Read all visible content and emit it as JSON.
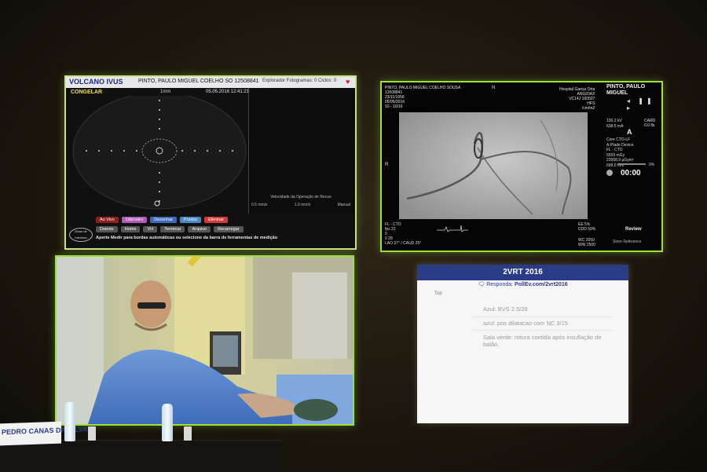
{
  "ivus": {
    "logo": "VOLCANO IVUS",
    "patient_header": "PINTO, PAULO MIGUEL COELHO SO   12508841",
    "header_right": "Explorador Fotogramas: 0   Ciclos: 0",
    "status": "CONGELAR",
    "scale_label": "1mm",
    "datetime": "05.05.2016 12:41:21",
    "pullback_label": "Velocidade da Operação de Recuo",
    "pullback_options": [
      "0.5 mm/s",
      "1.0 mm/s",
      "Manual"
    ],
    "buttons_row1": [
      {
        "label": "Ao Vivo",
        "color": "#8a1f1f"
      },
      {
        "label": "Diâmetro",
        "color": "#b05ab8"
      },
      {
        "label": "Desenhar",
        "color": "#3f6ab8"
      },
      {
        "label": "Pontos",
        "color": "#4a88c8"
      },
      {
        "label": "Eliminar",
        "color": "#d03c3c"
      }
    ],
    "buttons_row2": [
      "Doente",
      "Home",
      "VH",
      "Terminar",
      "Arquivo",
      "Recarregar"
    ],
    "mode_button": "Modo de Interface",
    "hint": "Aperte Medir para bordas automáticas ou selecione da barra de ferramentas de medição"
  },
  "angio": {
    "patient_lines": [
      "PINTO, PAULO MIGUEL COELHO SOUSA",
      "12508841",
      "23/11/1956",
      "05/05/2016",
      "10 - 10/16"
    ],
    "marker_n": "N",
    "hospital_lines": [
      "Hospital Garcia Orta",
      "ANGIOAX",
      "VC14J 160507",
      "HFS",
      "/cm/m2"
    ],
    "patient_name": "PINTO, PAULO MIGUEL",
    "controls": "◂ ❚❚ ▸",
    "stats_lines": [
      "100.2 kV",
      "638.5 mA",
      "",
      "",
      "Core CTO-LF",
      "A-Plade Device",
      "FL - CTO",
      "5559 mGy",
      "23958.9 µGym²",
      "699.0 mm"
    ],
    "stats_right": [
      "CARD",
      "0.0 fls"
    ],
    "panel_letter": "A",
    "timer": "00:00",
    "percent": "9%",
    "left_marker": "R",
    "bottom_lines": [
      "FL - CTO",
      "fps 22",
      "0",
      "0 28",
      "LAO 37° / CAUD 25°"
    ],
    "ee_lines": [
      "EE 5%",
      "DDD 59%"
    ],
    "vvc_lines": [
      "WC 2050",
      "WW 2500"
    ],
    "review_label": "Review",
    "store_label": "Store Reference"
  },
  "slide": {
    "title": "2VRT 2016",
    "subtitle_prefix": "Responda: ",
    "subtitle_link": "PollEv.com/2vrt2016",
    "section": "Top",
    "items": [
      "Azul: BVS 2.5/28",
      "azul: pos dilatacao com NC 3/15",
      "Sala verde: rotura contida após insuflação de balão."
    ]
  },
  "namecard": {
    "text": "PEDRO CANAS DA SILVA"
  }
}
